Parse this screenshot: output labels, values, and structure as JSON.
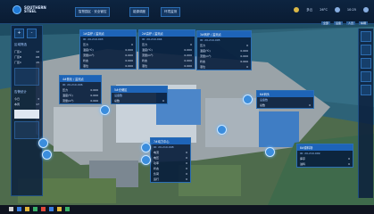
{
  "header": {
    "logo_text": "SOUTHERN\nSTEEL",
    "tabs": [
      "智慧园区 · 安全管控",
      "能源调度",
      "环境监测"
    ],
    "weather": "多云",
    "temp": "26°C",
    "time": "10:25",
    "subbar_buttons": [
      "全部",
      "设备",
      "人员",
      "车辆"
    ]
  },
  "left_panel": {
    "buttons": [
      "+",
      "-"
    ],
    "title": "区域筛选",
    "rows": [
      {
        "label": "厂区A",
        "value": "12"
      },
      {
        "label": "厂区B",
        "value": "08"
      },
      {
        "label": "厂区C",
        "value": "15"
      }
    ],
    "section2": "告警统计",
    "rows2": [
      {
        "label": "今日",
        "value": "3"
      },
      {
        "label": "本周",
        "value": "17"
      }
    ],
    "search_placeholder": "搜索"
  },
  "cards": [
    {
      "id": "c1",
      "title": "1#高炉 / 监测点",
      "sub": "ID: 20-210-003",
      "rows": [
        {
          "k": "压力",
          "v": "0"
        },
        {
          "k": "温度(℃)",
          "v": "0.000"
        },
        {
          "k": "流量(m³)",
          "v": "0.000"
        },
        {
          "k": "状态",
          "v": "0.000"
        },
        {
          "k": "液位",
          "v": "0.000"
        }
      ]
    },
    {
      "id": "c2",
      "title": "2#高炉 / 监测点",
      "sub": "ID: 20-210-004",
      "rows": [
        {
          "k": "压力",
          "v": "0"
        },
        {
          "k": "温度(℃)",
          "v": "0.000"
        },
        {
          "k": "流量(m³)",
          "v": "0.000"
        },
        {
          "k": "状态",
          "v": "0.000"
        },
        {
          "k": "液位",
          "v": "0.000"
        }
      ]
    },
    {
      "id": "c3",
      "title": "3#转炉 / 监测点",
      "sub": "ID: 20-210-005",
      "rows": [
        {
          "k": "压力",
          "v": "0"
        },
        {
          "k": "温度(℃)",
          "v": "0.000"
        },
        {
          "k": "流量(m³)",
          "v": "0.000"
        },
        {
          "k": "状态",
          "v": "0.000"
        },
        {
          "k": "液位",
          "v": "0"
        }
      ]
    },
    {
      "id": "c4",
      "title": "4#焦化 / 监测点",
      "sub": "ID: 20-210-006",
      "rows": [
        {
          "k": "压力",
          "v": "0.000"
        },
        {
          "k": "温度(℃)",
          "v": "0.000"
        },
        {
          "k": "流量(m³)",
          "v": "0.000"
        }
      ]
    },
    {
      "id": "c5",
      "title": "5#仓储区",
      "sub": "设备数",
      "rows": [
        {
          "k": "总数",
          "v": "0"
        }
      ]
    },
    {
      "id": "c6",
      "title": "6#码头",
      "sub": "设备数",
      "rows": [
        {
          "k": "总数",
          "v": "0"
        }
      ]
    },
    {
      "id": "c7",
      "title": "7#动力中心",
      "sub": "ID: 20-210-008",
      "rows": [
        {
          "k": "电流",
          "v": "0"
        },
        {
          "k": "电压",
          "v": "0"
        },
        {
          "k": "功率",
          "v": "0"
        },
        {
          "k": "状态",
          "v": "0"
        },
        {
          "k": "负荷",
          "v": "0"
        },
        {
          "k": "运行",
          "v": "0"
        }
      ]
    },
    {
      "id": "c8",
      "title": "8#原料场",
      "sub": "ID: 20-210-009",
      "rows": [
        {
          "k": "库存",
          "v": "0"
        },
        {
          "k": "进料",
          "v": "0"
        }
      ]
    }
  ]
}
